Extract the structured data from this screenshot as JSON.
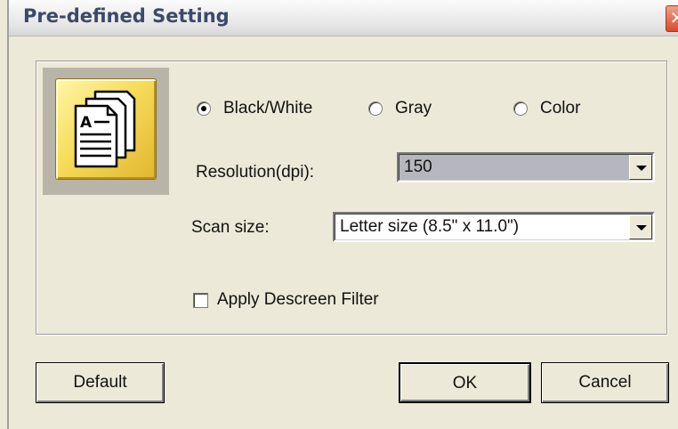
{
  "window": {
    "title": "Pre-defined Setting",
    "close_glyph": "✕"
  },
  "color_mode": {
    "options": [
      {
        "label": "Black/White",
        "selected": true
      },
      {
        "label": "Gray",
        "selected": false
      },
      {
        "label": "Color",
        "selected": false
      }
    ]
  },
  "resolution": {
    "label": "Resolution(dpi):",
    "value": "150"
  },
  "scan_size": {
    "label": "Scan size:",
    "value": "Letter size (8.5\" x 11.0\")"
  },
  "descreen": {
    "label": "Apply Descreen Filter",
    "checked": false
  },
  "buttons": {
    "default_label": "Default",
    "ok_label": "OK",
    "cancel_label": "Cancel"
  },
  "icons": {
    "preset": "documents-stack-icon"
  },
  "colors": {
    "icon_gold": "#f6dc5a",
    "dialog_bg": "#ece9d8",
    "title_text": "#3a4a6a"
  }
}
